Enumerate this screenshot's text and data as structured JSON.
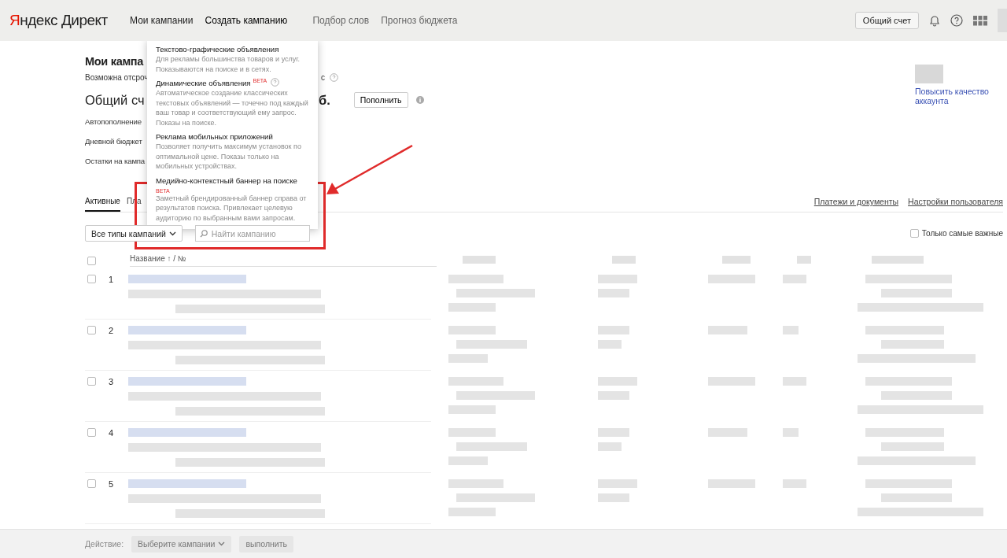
{
  "header": {
    "logo": {
      "brand": "Яндекс",
      "product": "Директ"
    },
    "nav": [
      {
        "label": "Мои кампании",
        "kind": "main",
        "expanded": false
      },
      {
        "label": "Создать кампанию",
        "kind": "main",
        "expanded": true
      },
      {
        "label": "Подбор слов",
        "kind": "secondary",
        "expanded": false
      },
      {
        "label": "Прогноз бюджета",
        "kind": "secondary",
        "expanded": false
      }
    ],
    "account_button": "Общий счет"
  },
  "create_menu": {
    "items": [
      {
        "title": "Текстово-графические объявления",
        "description": "Для рекламы большинства товаров и услуг. Показываются на поиске и в сетях.",
        "help": false
      },
      {
        "title": "Динамические объявления",
        "badge": "BETA",
        "description": "Автоматическое создание классических текстовых объявлений — точечно под каждый ваш товар и соответствующий ему запрос. Показы на поиске.",
        "help": true
      },
      {
        "title": "Реклама мобильных приложений",
        "description": "Позволяет получить максимум установок по оптимальной цене. Показы только на мобильных устройствах.",
        "help": false
      },
      {
        "title": "Медийно-контекстный баннер на поиске",
        "badge": "BETA",
        "description": "Заметный брендированный баннер справа от результатов поиска. Привлекает целевую аудиторию по выбранным вами запросам.",
        "help": false
      }
    ]
  },
  "page": {
    "title": "Мои кампа",
    "deferral_note": "Возможна отсроч",
    "deferral_note_tail": "с",
    "account_title": "Общий сч",
    "account_title_tail": "б.",
    "top_up_button": "Пополнить",
    "settings": [
      "Автопополнение",
      "Дневной бюджет",
      "Остатки на кампа"
    ],
    "quality_link": "Повысить качество аккаунта"
  },
  "tabs": [
    {
      "label": "Активные",
      "selected": true
    },
    {
      "label": "Пла",
      "selected": false
    }
  ],
  "links": [
    "Платежи и документы",
    "Настройки пользователя"
  ],
  "filters": {
    "type_select": "Все типы кампаний",
    "search_placeholder": "Найти кампанию",
    "important_only": {
      "label": "Только самые важные",
      "checked": false
    }
  },
  "table": {
    "name_column": "Название ↑ / №",
    "header_checked": false,
    "rows": [
      {
        "number": "1",
        "checked": false
      },
      {
        "number": "2",
        "checked": false
      },
      {
        "number": "3",
        "checked": false
      },
      {
        "number": "4",
        "checked": false
      },
      {
        "number": "5",
        "checked": false
      }
    ]
  },
  "footer": {
    "action_label": "Действие:",
    "select": "Выберите кампании",
    "run_button": "выполнить"
  }
}
